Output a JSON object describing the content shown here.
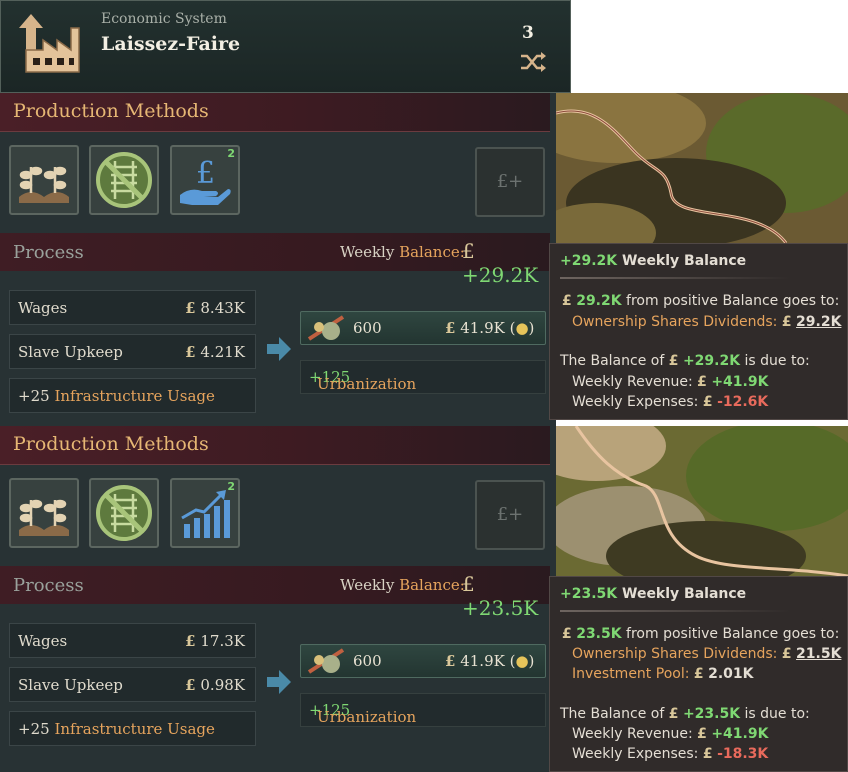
{
  "header": {
    "subtitle": "Economic System",
    "title": "Laissez-Faire",
    "count": "3",
    "icon": "factory-arrow-icon"
  },
  "panels": [
    {
      "pm_title": "Production Methods",
      "pm_icons": [
        "plants-icon",
        "no-railway-icon",
        "pound-hand-icon"
      ],
      "pm_badge": "2",
      "add_button_label": "£+",
      "process_label": "Process",
      "weekly_label": "Weekly",
      "balance_label": "Balance:",
      "balance_value": "+29.2K",
      "inputs": [
        {
          "label": "Wages",
          "value": "8.43K"
        },
        {
          "label": "Slave Upkeep",
          "value": "4.21K"
        },
        {
          "prefix": "+25",
          "label": "Infrastructure Usage"
        }
      ],
      "output": {
        "amount": "600",
        "price": "41.9K"
      },
      "urbanization": {
        "value": "+125",
        "label": "Urbanization"
      }
    },
    {
      "pm_title": "Production Methods",
      "pm_icons": [
        "plants-icon",
        "no-railway-icon",
        "rising-chart-icon"
      ],
      "pm_badge": "2",
      "add_button_label": "£+",
      "process_label": "Process",
      "weekly_label": "Weekly",
      "balance_label": "Balance:",
      "balance_value": "+23.5K",
      "inputs": [
        {
          "label": "Wages",
          "value": "17.3K"
        },
        {
          "label": "Slave Upkeep",
          "value": "0.98K"
        },
        {
          "prefix": "+25",
          "label": "Infrastructure Usage"
        }
      ],
      "output": {
        "amount": "600",
        "price": "41.9K"
      },
      "urbanization": {
        "value": "+125",
        "label": "Urbanization"
      }
    }
  ],
  "tooltips": [
    {
      "head_value": "+29.2K",
      "head_label": "Weekly Balance",
      "positive_value": "29.2K",
      "positive_text": "from positive Balance goes to:",
      "destinations": [
        {
          "label": "Ownership Shares Dividends:",
          "value": "29.2K"
        }
      ],
      "due_prefix": "The Balance of",
      "due_value": "+29.2K",
      "due_suffix": "is due to:",
      "revenue_label": "Weekly Revenue:",
      "revenue_value": "+41.9K",
      "expenses_label": "Weekly Expenses:",
      "expenses_value": "-12.6K"
    },
    {
      "head_value": "+23.5K",
      "head_label": "Weekly Balance",
      "positive_value": "23.5K",
      "positive_text": "from positive Balance goes to:",
      "destinations": [
        {
          "label": "Ownership Shares Dividends:",
          "value": "21.5K"
        },
        {
          "label": "Investment Pool:",
          "value": "2.01K"
        }
      ],
      "due_prefix": "The Balance of",
      "due_value": "+23.5K",
      "due_suffix": "is due to:",
      "revenue_label": "Weekly Revenue:",
      "revenue_value": "+41.9K",
      "expenses_label": "Weekly Expenses:",
      "expenses_value": "-18.3K"
    }
  ],
  "currency_symbol": "£",
  "colors": {
    "positive": "#7fd873",
    "negative": "#e86a5c",
    "accent": "#e6a45d",
    "title": "#e6b774"
  }
}
